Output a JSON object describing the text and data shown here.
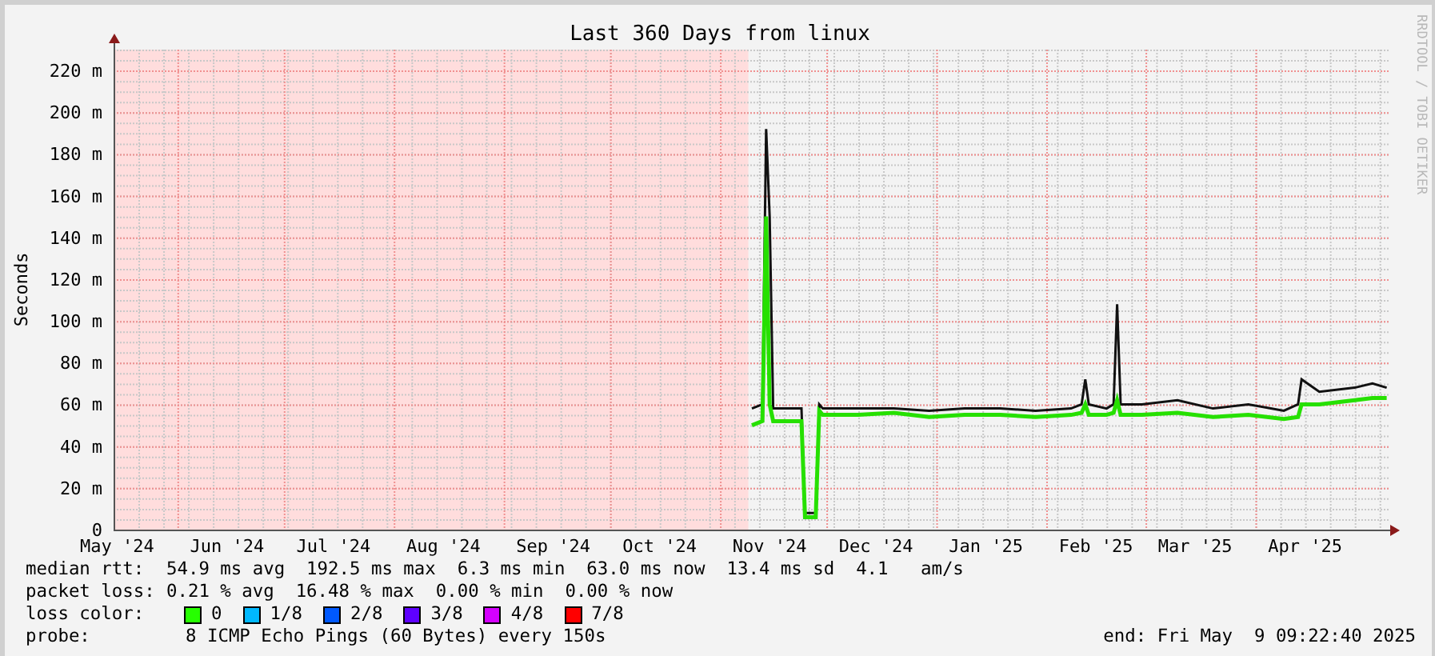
{
  "graph": {
    "side_note": "RRDTOOL / TOBI OETIKER",
    "chart_data": {
      "type": "line",
      "title": "Last 360 Days from linux",
      "ylabel": "Seconds",
      "xlim": [
        "2024-05-14",
        "2025-05-09"
      ],
      "ylim": [
        0,
        230
      ],
      "grid": true,
      "x": [
        "2024-11-10",
        "2024-11-13",
        "2024-11-14",
        "2024-11-15",
        "2024-11-16",
        "2024-11-20",
        "2024-11-24",
        "2024-11-25",
        "2024-11-28",
        "2024-11-29",
        "2024-11-30",
        "2024-12-10",
        "2024-12-20",
        "2024-12-30",
        "2025-01-09",
        "2025-01-19",
        "2025-01-29",
        "2025-02-08",
        "2025-02-11",
        "2025-02-12",
        "2025-02-13",
        "2025-02-18",
        "2025-02-20",
        "2025-02-21",
        "2025-02-22",
        "2025-02-28",
        "2025-03-10",
        "2025-03-20",
        "2025-03-30",
        "2025-04-09",
        "2025-04-13",
        "2025-04-14",
        "2025-04-19",
        "2025-04-29",
        "2025-05-04",
        "2025-05-08"
      ],
      "series": [
        {
          "color": "#111111",
          "values": [
            58,
            60,
            192,
            150,
            58,
            58,
            58,
            8,
            8,
            60,
            58,
            58,
            58,
            57,
            58,
            58,
            57,
            58,
            60,
            72,
            60,
            58,
            60,
            108,
            60,
            60,
            62,
            58,
            60,
            57,
            60,
            72,
            66,
            68,
            70,
            68
          ]
        },
        {
          "color": "#26e000",
          "values": [
            50,
            52,
            150,
            60,
            52,
            52,
            52,
            6,
            6,
            57,
            55,
            55,
            56,
            54,
            55,
            55,
            54,
            55,
            56,
            60,
            55,
            55,
            56,
            62,
            55,
            55,
            56,
            54,
            55,
            53,
            54,
            60,
            60,
            62,
            63,
            63
          ]
        }
      ],
      "xticks": [
        {
          "value": "2024-05-15",
          "label": "May '24"
        },
        {
          "value": "2024-06-15",
          "label": "Jun '24"
        },
        {
          "value": "2024-07-15",
          "label": "Jul '24"
        },
        {
          "value": "2024-08-15",
          "label": "Aug '24"
        },
        {
          "value": "2024-09-15",
          "label": "Sep '24"
        },
        {
          "value": "2024-10-15",
          "label": "Oct '24"
        },
        {
          "value": "2024-11-15",
          "label": "Nov '24"
        },
        {
          "value": "2024-12-15",
          "label": "Dec '24"
        },
        {
          "value": "2025-01-15",
          "label": "Jan '25"
        },
        {
          "value": "2025-02-15",
          "label": "Feb '25"
        },
        {
          "value": "2025-03-15",
          "label": "Mar '25"
        },
        {
          "value": "2025-04-15",
          "label": "Apr '25"
        }
      ],
      "yticks": [
        {
          "value": 0,
          "label": "0"
        },
        {
          "value": 20,
          "label": "20 m"
        },
        {
          "value": 40,
          "label": "40 m"
        },
        {
          "value": 60,
          "label": "60 m"
        },
        {
          "value": 80,
          "label": "80 m"
        },
        {
          "value": 100,
          "label": "100 m"
        },
        {
          "value": 120,
          "label": "120 m"
        },
        {
          "value": 140,
          "label": "140 m"
        },
        {
          "value": 160,
          "label": "160 m"
        },
        {
          "value": 180,
          "label": "180 m"
        },
        {
          "value": 200,
          "label": "200 m"
        },
        {
          "value": 220,
          "label": "220 m"
        }
      ]
    }
  },
  "legend": {
    "rows": [
      {
        "label": "median rtt:",
        "value": "54.9 ms avg  192.5 ms max  6.3 ms min  63.0 ms now  13.4 ms sd  4.1   am/s"
      },
      {
        "label": "packet loss:",
        "value": "0.21 % avg  16.48 % max  0.00 % min  0.00 % now"
      }
    ],
    "loss_label": "loss color:",
    "loss_colors": [
      {
        "label": "0",
        "color": "#26ff00"
      },
      {
        "label": "1/8",
        "color": "#00b8ff"
      },
      {
        "label": "2/8",
        "color": "#0059ff"
      },
      {
        "label": "3/8",
        "color": "#5e00ff"
      },
      {
        "label": "4/8",
        "color": "#d400ff"
      },
      {
        "label": "7/8",
        "color": "#ff0000"
      }
    ],
    "probe_label": "probe:",
    "probe": "8 ICMP Echo Pings (60 Bytes) every 150s",
    "end": "end: Fri May  9 09:22:40 2025"
  }
}
